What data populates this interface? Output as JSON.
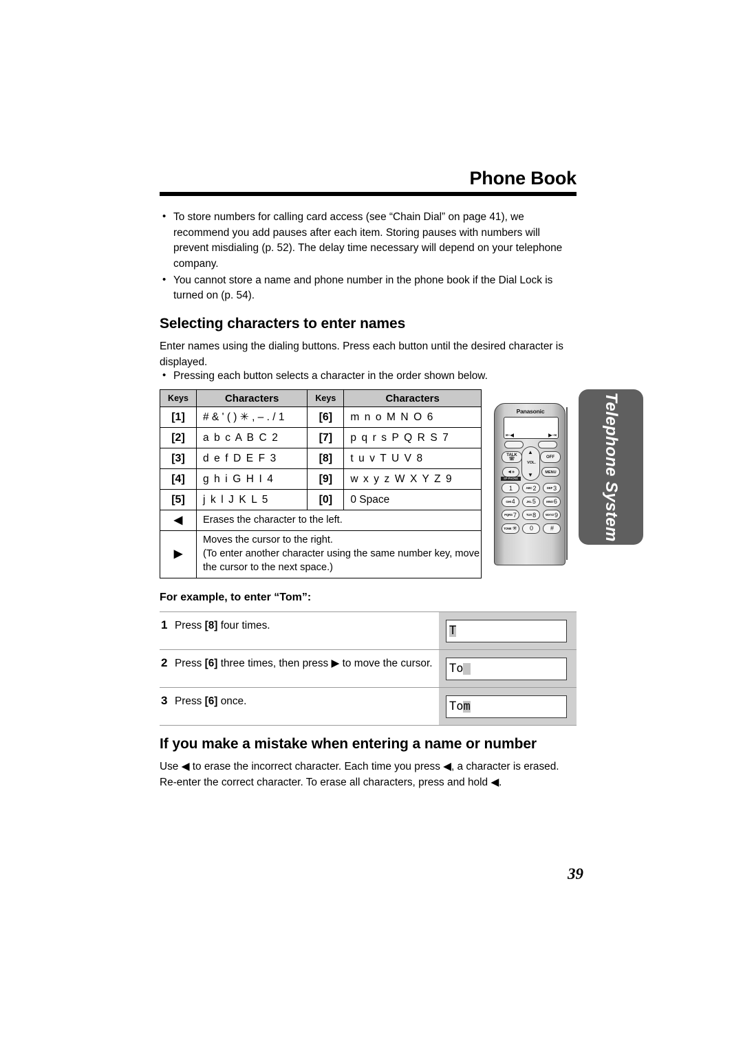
{
  "header": {
    "title": "Phone Book"
  },
  "intro_bullets": [
    "To store numbers for calling card access (see “Chain Dial” on page 41), we recommend you add pauses after each item. Storing pauses with numbers will prevent misdialing (p. 52). The delay time necessary will depend on your telephone company.",
    "You cannot store a name and phone number in the phone book if the Dial Lock is turned on (p. 54)."
  ],
  "section_selecting": {
    "heading": "Selecting characters to enter names",
    "paragraph": "Enter names using the dialing buttons. Press each button until the desired character is displayed.",
    "bullet": "Pressing each button selects a character in the order shown below."
  },
  "char_table": {
    "headers": {
      "keys": "Keys",
      "characters": "Characters"
    },
    "rows": [
      {
        "left_key": "[1]",
        "left_chars": "# & ' ( ) ✳ , – . / 1",
        "right_key": "[6]",
        "right_chars": "m n o M N O 6"
      },
      {
        "left_key": "[2]",
        "left_chars": "a b c A B C 2",
        "right_key": "[7]",
        "right_chars": "p q r s P Q R S 7"
      },
      {
        "left_key": "[3]",
        "left_chars": "d e f D E F 3",
        "right_key": "[8]",
        "right_chars": "t u v T U V 8"
      },
      {
        "left_key": "[4]",
        "left_chars": "g h i G H I 4",
        "right_key": "[9]",
        "right_chars": "w x y z W X Y Z 9"
      },
      {
        "left_key": "[5]",
        "left_chars": "j k l J K L 5",
        "right_key": "[0]",
        "right_chars": "0  Space"
      }
    ],
    "nav_rows": [
      {
        "arrow": "◀",
        "text": "Erases the character to the left."
      },
      {
        "arrow": "▶",
        "text": "Moves the cursor to the right.\n(To enter another character using the same number key, move the cursor to the next space.)"
      }
    ]
  },
  "phone": {
    "brand": "Panasonic",
    "lcd_indicator_left": "⇤◀",
    "lcd_indicator_right": "▶⇥",
    "buttons": {
      "talk": "TALK",
      "off": "OFF",
      "speaker": "◄»",
      "speaker_label": "SP-PHONE",
      "menu": "MENU",
      "vol": "VOL."
    },
    "keypad": [
      [
        {
          "sub": "",
          "num": "1"
        },
        {
          "sub": "ABC",
          "num": "2"
        },
        {
          "sub": "DEF",
          "num": "3"
        }
      ],
      [
        {
          "sub": "GHI",
          "num": "4"
        },
        {
          "sub": "JKL",
          "num": "5"
        },
        {
          "sub": "MNO",
          "num": "6"
        }
      ],
      [
        {
          "sub": "PQRS",
          "num": "7"
        },
        {
          "sub": "TUV",
          "num": "8"
        },
        {
          "sub": "WXYZ",
          "num": "9"
        }
      ],
      [
        {
          "sub": "TONE",
          "num": "✳"
        },
        {
          "sub": "",
          "num": "0"
        },
        {
          "sub": "",
          "num": "#"
        }
      ]
    ]
  },
  "side_tab": {
    "label": "Telephone System",
    "color": "#5f5f5f"
  },
  "example": {
    "heading": "For example, to enter “Tom”:",
    "steps": [
      {
        "num": "1",
        "text_before": "Press ",
        "key": "[8]",
        "text_after": " four times.",
        "display_text": "T",
        "display_cursor_before": 0,
        "display_cursor_len": 1
      },
      {
        "num": "2",
        "text_before": "Press ",
        "key": "[6]",
        "text_after": " three times, then press ▶ to move the cursor.",
        "display_text": "To",
        "display_cursor_before": 2,
        "display_cursor_len": 1
      },
      {
        "num": "3",
        "text_before": "Press ",
        "key": "[6]",
        "text_after": " once.",
        "display_text": "Tom",
        "display_cursor_before": 2,
        "display_cursor_len": 1
      }
    ]
  },
  "section_mistake": {
    "heading": "If you make a mistake when entering a name or number",
    "paragraph": "Use ◀ to erase the incorrect character. Each time you press ◀, a character is erased. Re-enter the correct character. To erase all characters, press and hold ◀."
  },
  "footer": {
    "page_number": "39"
  }
}
